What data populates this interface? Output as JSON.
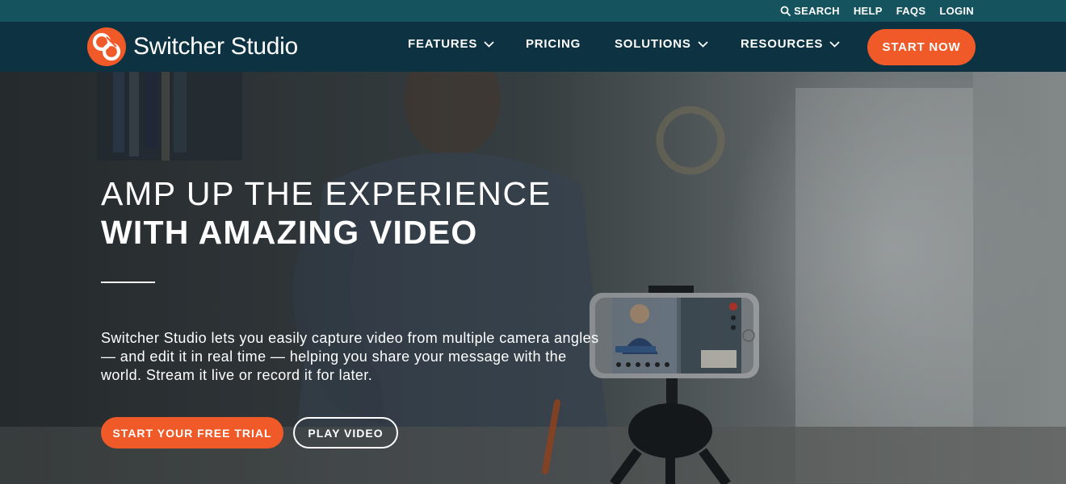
{
  "utility_bar": {
    "search_label": "SEARCH",
    "help_label": "HELP",
    "faqs_label": "FAQS",
    "login_label": "LOGIN"
  },
  "brand": {
    "name": "Switcher Studio",
    "accent_color": "#f05a28",
    "nav_bg": "#0d3342",
    "utility_bg": "#15535f"
  },
  "nav": {
    "items": [
      {
        "label": "FEATURES",
        "has_dropdown": true
      },
      {
        "label": "PRICING",
        "has_dropdown": false
      },
      {
        "label": "SOLUTIONS",
        "has_dropdown": true
      },
      {
        "label": "RESOURCES",
        "has_dropdown": true
      }
    ],
    "cta_label": "START NOW"
  },
  "hero": {
    "title_light": "AMP UP THE EXPERIENCE",
    "title_bold": "WITH AMAZING VIDEO",
    "description": "Switcher Studio lets you easily capture video from multiple camera angles — and edit it in real time — helping you share your message with the world. Stream it live or record it for later.",
    "primary_button": "START YOUR FREE TRIAL",
    "secondary_button": "PLAY VIDEO",
    "phone_lower_third": "WILLAMINA JEWELRY"
  }
}
